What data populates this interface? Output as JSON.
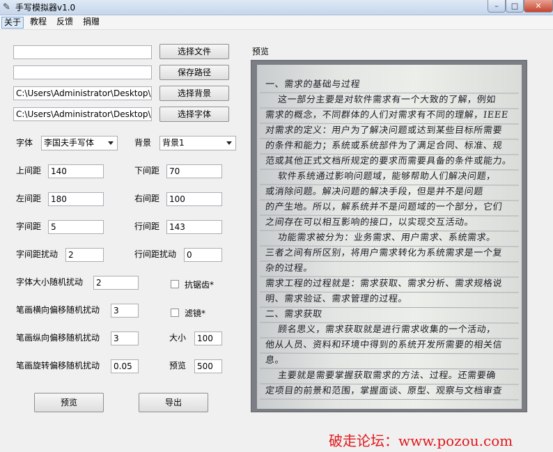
{
  "window": {
    "title": "手写模拟器v1.0",
    "icon": "feather-pen-icon",
    "controls": {
      "minimize": "–",
      "maximize": "□",
      "close": "✕"
    }
  },
  "menu": [
    "关于",
    "教程",
    "反馈",
    "捐赠"
  ],
  "files": {
    "text_file": {
      "value": "",
      "button": "选择文件"
    },
    "save_path": {
      "value": "",
      "button": "保存路径"
    },
    "background": {
      "value": "C:\\Users\\Administrator\\Desktop\\",
      "button": "选择背景"
    },
    "font": {
      "value": "C:\\Users\\Administrator\\Desktop\\",
      "button": "选择字体"
    }
  },
  "font_select": {
    "label": "字体",
    "value": "李国夫手写体"
  },
  "bg_select": {
    "label": "背景",
    "value": "背景1"
  },
  "fields": {
    "top_margin": {
      "label": "上间距",
      "value": "140"
    },
    "bottom_margin": {
      "label": "下间距",
      "value": "70"
    },
    "left_margin": {
      "label": "左间距",
      "value": "180"
    },
    "right_margin": {
      "label": "右间距",
      "value": "100"
    },
    "char_spacing": {
      "label": "字间距",
      "value": "5"
    },
    "line_spacing": {
      "label": "行间距",
      "value": "143"
    },
    "char_spacing_jitter": {
      "label": "字间距扰动",
      "value": "2"
    },
    "line_spacing_jitter": {
      "label": "行间距扰动",
      "value": "0"
    },
    "font_size_jitter": {
      "label": "字体大小随机扰动",
      "value": "2"
    },
    "stroke_h_jitter": {
      "label": "笔画横向偏移随机扰动",
      "value": "3"
    },
    "stroke_v_jitter": {
      "label": "笔画纵向偏移随机扰动",
      "value": "3"
    },
    "stroke_rot_jitter": {
      "label": "笔画旋转偏移随机扰动",
      "value": "0.05"
    },
    "size": {
      "label": "大小",
      "value": "100"
    },
    "preview_size": {
      "label": "预览",
      "value": "500"
    }
  },
  "checkboxes": {
    "antialias": {
      "label": "抗锯齿*",
      "checked": false
    },
    "filter": {
      "label": "滤镜*",
      "checked": false
    }
  },
  "actions": {
    "preview": "预览",
    "export": "导出"
  },
  "preview": {
    "label": "预览",
    "lines": [
      "一、需求的基础与过程",
      "这一部分主要是对软件需求有一个大致的了解，例如",
      "需求的概念，不同群体的人们对需求有不同的理解，IEEE",
      "对需求的定义：用户为了解决问题或达到某些目标所需要",
      "的条件和能力；系统或系统部件为了满足合同、标准、规",
      "范或其他正式文档所规定的要求而需要具备的条件或能力。",
      "软件系统通过影响问题域，能够帮助人们解决问题，",
      "或消除问题。解决问题的解决手段，但是并不是问题",
      "的产生地。所以，解系统并不是问题域的一个部分，它们",
      "之间存在可以相互影响的接口，以实现交互活动。",
      "功能需求被分为：业务需求、用户需求、系统需求。",
      "三者之间有所区别，将用户需求转化为系统需求是一个复",
      "杂的过程。",
      "需求工程的过程就是：需求获取、需求分析、需求规格说",
      "明、需求验证、需求管理的过程。",
      "二、需求获取",
      "顾名思义，需求获取就是进行需求收集的一个活动，",
      "他从人员、资料和环境中得到的系统开发所需要的相关信",
      "息。",
      "主要就是需要掌握获取需求的方法、过程。还需要确",
      "定项目的前景和范围，掌握面谈、原型、观察与文档审查"
    ]
  },
  "watermark": "破走论坛：www.pozou.com"
}
